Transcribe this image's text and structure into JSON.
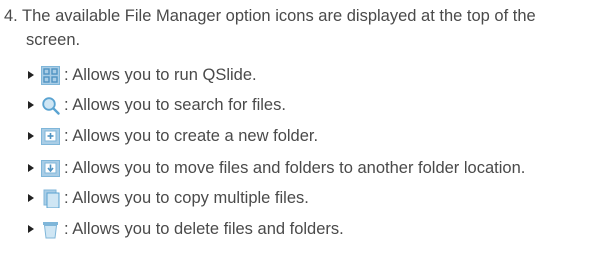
{
  "step": {
    "line1": "4. The available File Manager option icons are displayed at the top of the",
    "line2": "screen."
  },
  "items": [
    {
      "icon": "qslide-icon",
      "text": ": Allows you to run QSlide."
    },
    {
      "icon": "search-icon",
      "text": ": Allows you to search for files."
    },
    {
      "icon": "new-folder-icon",
      "text": ": Allows you to create a new folder."
    },
    {
      "icon": "move-icon",
      "text": ": Allows you to move files and folders to another folder location."
    },
    {
      "icon": "copy-icon",
      "text": ": Allows you to copy multiple files."
    },
    {
      "icon": "delete-icon",
      "text": ": Allows you to delete files and folders."
    }
  ],
  "colors": {
    "text": "#4a4a4a",
    "icon_blue": "#7fb6d9",
    "icon_dark": "#4f93c2"
  }
}
